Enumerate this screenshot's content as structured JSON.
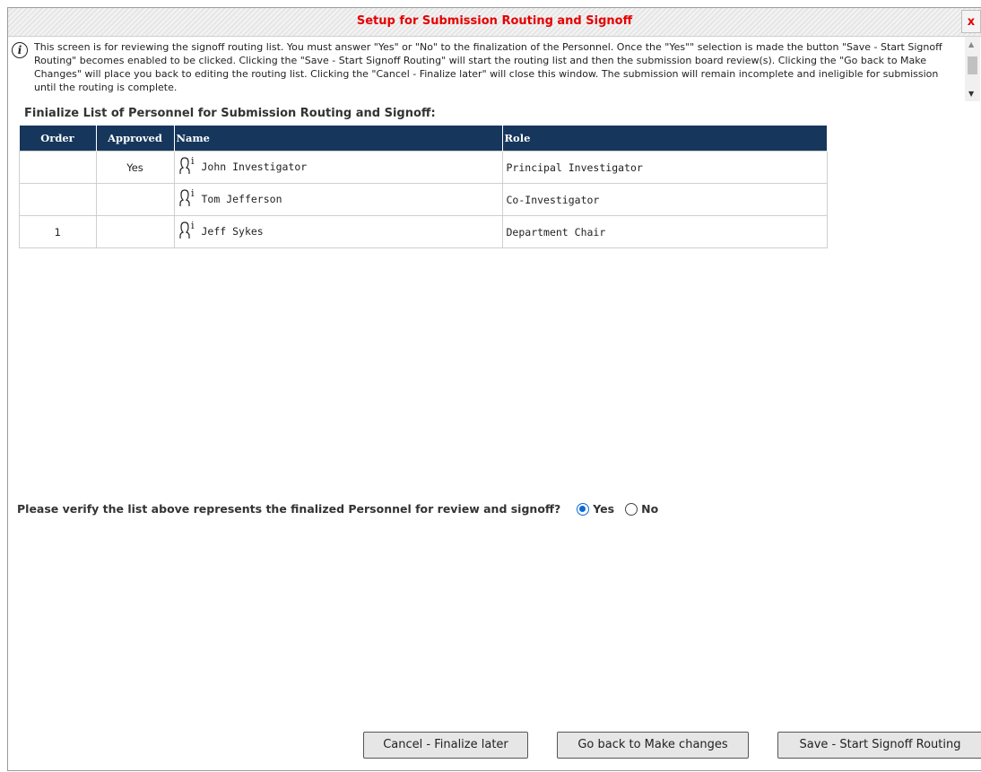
{
  "dialog": {
    "title": "Setup for Submission Routing and Signoff",
    "close_label": "x"
  },
  "notice": {
    "icon": "info-icon",
    "text": "This screen is for reviewing the signoff routing list. You must answer \"Yes\" or \"No\" to the finalization of the Personnel. Once the \"Yes\"\" selection is made the button \"Save - Start Signoff Routing\" becomes enabled to be clicked. Clicking the \"Save - Start Signoff Routing\" will start the routing list and then the submission board review(s). Clicking the \"Go back to Make Changes\" will place you back to editing the routing list. Clicking the \"Cancel - Finalize later\" will close this window. The submission will remain incomplete and ineligible for submission until the routing is complete."
  },
  "section_title": "Finialize List of Personnel for Submission Routing and Signoff:",
  "table": {
    "headers": [
      "Order",
      "Approved",
      "Name",
      "Role"
    ],
    "rows": [
      {
        "order": "",
        "approved": "Yes",
        "name": "John Investigator",
        "role": "Principal Investigator"
      },
      {
        "order": "",
        "approved": "",
        "name": "Tom Jefferson",
        "role": "Co-Investigator"
      },
      {
        "order": "1",
        "approved": "",
        "name": "Jeff Sykes",
        "role": "Department Chair"
      }
    ]
  },
  "verify": {
    "question": "Please verify the list above represents the finalized Personnel for review and signoff?",
    "options": [
      "Yes",
      "No"
    ],
    "selected": "Yes"
  },
  "buttons": {
    "cancel": "Cancel - Finalize later",
    "back": "Go back to Make changes",
    "save": "Save - Start Signoff Routing"
  },
  "colors": {
    "title": "#e60000",
    "header_bg": "#16365c",
    "radio_accent": "#0a6ad6"
  }
}
